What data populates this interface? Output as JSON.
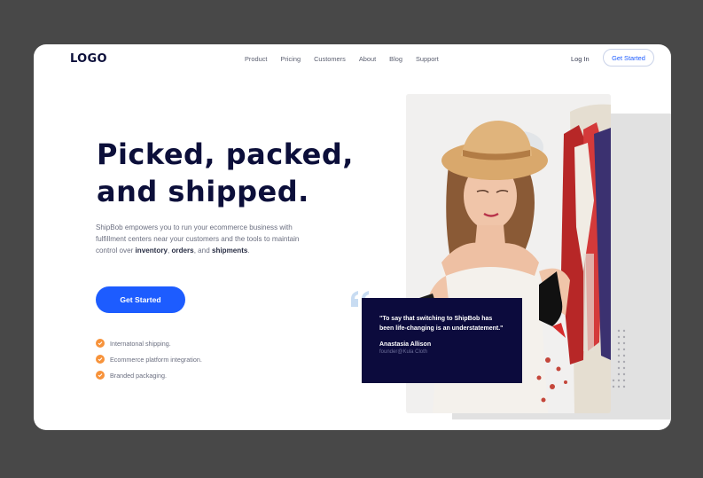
{
  "header": {
    "logo": "LOGO",
    "nav": [
      "Product",
      "Pricing",
      "Customers",
      "About",
      "Blog",
      "Support"
    ],
    "login": "Log In",
    "cta": "Get Started"
  },
  "hero": {
    "title_line1": "Picked, packed,",
    "title_line2": "and shipped.",
    "desc_start": "ShipBob empowers you to run your ecommerce business with fulfillment centers near your customers and the tools to maintain control over ",
    "desc_bold1": "inventory",
    "desc_sep": ", ",
    "desc_bold2": "orders",
    "desc_and": ", and ",
    "desc_bold3": "shipments",
    "desc_end": ".",
    "cta": "Get Started",
    "features": [
      "Internatonal shipping.",
      "Ecommerce platform integration.",
      "Branded packaging."
    ]
  },
  "testimonial": {
    "quote": "\"To say that switching to ShipBob has been life-changing is an understatement.\"",
    "name": "Anastasia Allison",
    "role": "founder@Kula Cloth"
  },
  "colors": {
    "background": "#484848",
    "primary": "#1d5cff",
    "navy": "#0c0f3a",
    "check": "#f7933b",
    "quote_mark": "#c8dcf2"
  }
}
